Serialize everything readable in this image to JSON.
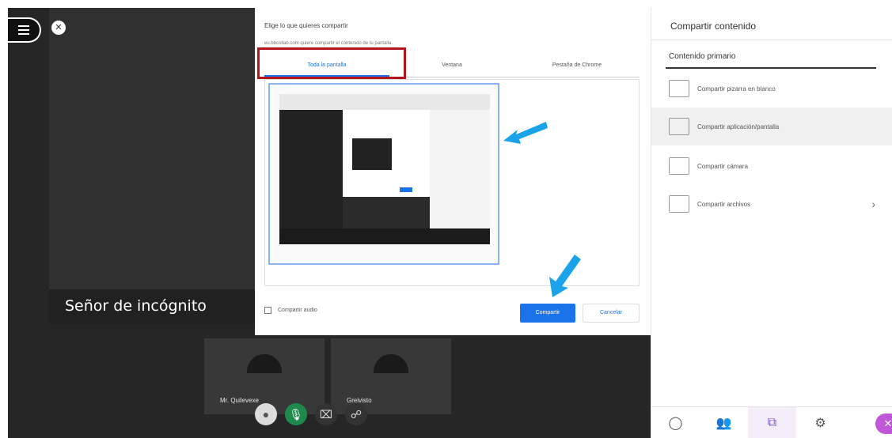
{
  "stage": {
    "main_participant_name": "Señor de incógnito",
    "tiles": [
      {
        "name": "Mr. Quilevexe"
      },
      {
        "name": "Greivisto"
      }
    ],
    "icons": {
      "menu": "hamburger-icon",
      "mute": "muted-mic-icon",
      "avatar": "avatar-icon",
      "mic": "microphone-icon",
      "camera": "camera-off-icon",
      "share": "share-person-icon"
    }
  },
  "dialog": {
    "title": "Elige lo que quieres compartir",
    "subtitle": "eu.bbcollab.com quiere compartir el contenido de tu pantalla.",
    "tabs": [
      "Toda la pantalla",
      "Ventana",
      "Pestaña de Chrome"
    ],
    "active_tab": 0,
    "audio_label": "Compartir audio",
    "share_label": "Compartir",
    "cancel_label": "Cancelar",
    "highlight_color": "#b3151a",
    "accent_color": "#1a73e8"
  },
  "panel": {
    "title": "Compartir contenido",
    "section": "Contenido primario",
    "options": [
      {
        "label": "Compartir pizarra en blanco",
        "icon": "whiteboard-icon",
        "selected": false
      },
      {
        "label": "Compartir aplicación/pantalla",
        "icon": "screen-share-icon",
        "selected": true
      },
      {
        "label": "Compartir cámara",
        "icon": "camera-share-icon",
        "selected": false
      },
      {
        "label": "Compartir archivos",
        "icon": "folder-icon",
        "selected": false,
        "chevron": "›"
      }
    ],
    "bottom_icons": [
      "chat-icon",
      "participants-icon",
      "share-content-icon",
      "settings-icon",
      "close-icon"
    ],
    "arrow_color": "#1aa3e8"
  }
}
